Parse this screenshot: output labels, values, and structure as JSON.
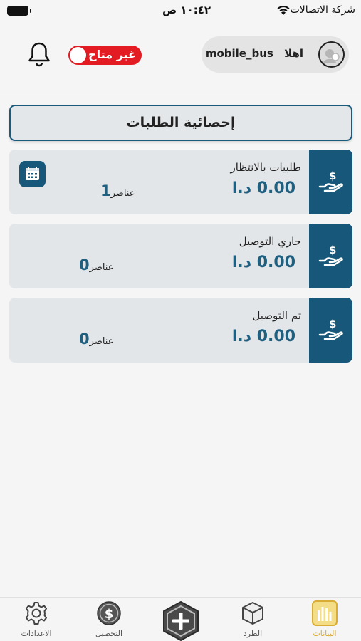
{
  "status_bar": {
    "carrier": "شركة الاتصالات",
    "time": "١٠:٤٢ ص"
  },
  "header": {
    "availability_label": "غير متاح",
    "greeting_label": "اهلا",
    "username": "mobile_bus"
  },
  "page_title": "إحصائية الطلبات",
  "cards": [
    {
      "title": "طلبيات بالانتظار",
      "amount": "0.00 د.ا",
      "count": "1",
      "count_unit": "عناصر",
      "has_calendar": true
    },
    {
      "title": "جاري التوصيل",
      "amount": "0.00 د.ا",
      "count": "0",
      "count_unit": "عناصر",
      "has_calendar": false
    },
    {
      "title": "تم التوصيل",
      "amount": "0.00 د.ا",
      "count": "0",
      "count_unit": "عناصر",
      "has_calendar": false
    }
  ],
  "bottom_nav": {
    "items": [
      {
        "label": "البيانات",
        "icon": "chart-bars-icon",
        "active": true
      },
      {
        "label": "الطرد",
        "icon": "box-icon",
        "active": false
      },
      {
        "label": "",
        "icon": "add-hexagon-icon",
        "active": false
      },
      {
        "label": "التحصيل",
        "icon": "dollar-coin-icon",
        "active": false
      },
      {
        "label": "الاعدادات",
        "icon": "gear-icon",
        "active": false
      }
    ]
  },
  "colors": {
    "primary": "#17587a",
    "amount": "#1f5f80",
    "toggle_off": "#e31b23",
    "nav_active": "#d9ad35",
    "card_bg": "#e3e6e9"
  }
}
